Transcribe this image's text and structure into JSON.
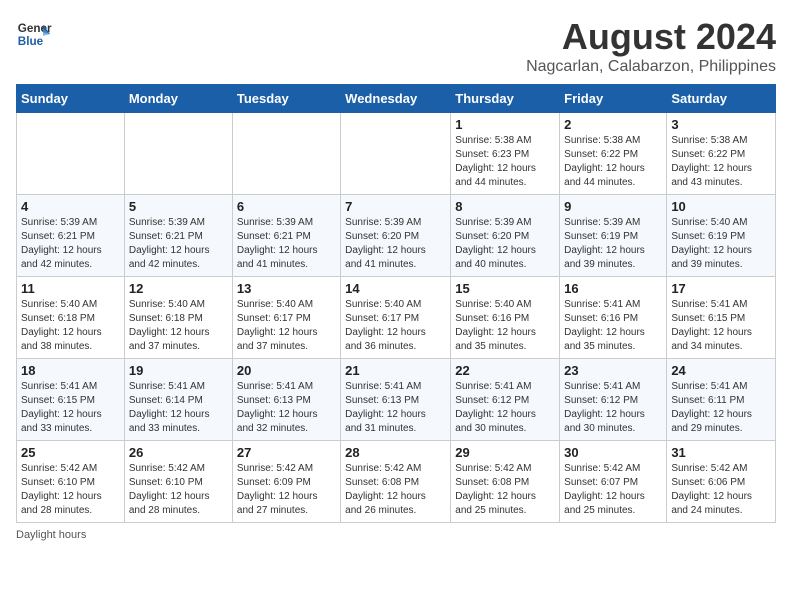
{
  "header": {
    "logo_line1": "General",
    "logo_line2": "Blue",
    "title": "August 2024",
    "subtitle": "Nagcarlan, Calabarzon, Philippines"
  },
  "days_of_week": [
    "Sunday",
    "Monday",
    "Tuesday",
    "Wednesday",
    "Thursday",
    "Friday",
    "Saturday"
  ],
  "weeks": [
    [
      {
        "day": "",
        "info": ""
      },
      {
        "day": "",
        "info": ""
      },
      {
        "day": "",
        "info": ""
      },
      {
        "day": "",
        "info": ""
      },
      {
        "day": "1",
        "info": "Sunrise: 5:38 AM\nSunset: 6:23 PM\nDaylight: 12 hours\nand 44 minutes."
      },
      {
        "day": "2",
        "info": "Sunrise: 5:38 AM\nSunset: 6:22 PM\nDaylight: 12 hours\nand 44 minutes."
      },
      {
        "day": "3",
        "info": "Sunrise: 5:38 AM\nSunset: 6:22 PM\nDaylight: 12 hours\nand 43 minutes."
      }
    ],
    [
      {
        "day": "4",
        "info": "Sunrise: 5:39 AM\nSunset: 6:21 PM\nDaylight: 12 hours\nand 42 minutes."
      },
      {
        "day": "5",
        "info": "Sunrise: 5:39 AM\nSunset: 6:21 PM\nDaylight: 12 hours\nand 42 minutes."
      },
      {
        "day": "6",
        "info": "Sunrise: 5:39 AM\nSunset: 6:21 PM\nDaylight: 12 hours\nand 41 minutes."
      },
      {
        "day": "7",
        "info": "Sunrise: 5:39 AM\nSunset: 6:20 PM\nDaylight: 12 hours\nand 41 minutes."
      },
      {
        "day": "8",
        "info": "Sunrise: 5:39 AM\nSunset: 6:20 PM\nDaylight: 12 hours\nand 40 minutes."
      },
      {
        "day": "9",
        "info": "Sunrise: 5:39 AM\nSunset: 6:19 PM\nDaylight: 12 hours\nand 39 minutes."
      },
      {
        "day": "10",
        "info": "Sunrise: 5:40 AM\nSunset: 6:19 PM\nDaylight: 12 hours\nand 39 minutes."
      }
    ],
    [
      {
        "day": "11",
        "info": "Sunrise: 5:40 AM\nSunset: 6:18 PM\nDaylight: 12 hours\nand 38 minutes."
      },
      {
        "day": "12",
        "info": "Sunrise: 5:40 AM\nSunset: 6:18 PM\nDaylight: 12 hours\nand 37 minutes."
      },
      {
        "day": "13",
        "info": "Sunrise: 5:40 AM\nSunset: 6:17 PM\nDaylight: 12 hours\nand 37 minutes."
      },
      {
        "day": "14",
        "info": "Sunrise: 5:40 AM\nSunset: 6:17 PM\nDaylight: 12 hours\nand 36 minutes."
      },
      {
        "day": "15",
        "info": "Sunrise: 5:40 AM\nSunset: 6:16 PM\nDaylight: 12 hours\nand 35 minutes."
      },
      {
        "day": "16",
        "info": "Sunrise: 5:41 AM\nSunset: 6:16 PM\nDaylight: 12 hours\nand 35 minutes."
      },
      {
        "day": "17",
        "info": "Sunrise: 5:41 AM\nSunset: 6:15 PM\nDaylight: 12 hours\nand 34 minutes."
      }
    ],
    [
      {
        "day": "18",
        "info": "Sunrise: 5:41 AM\nSunset: 6:15 PM\nDaylight: 12 hours\nand 33 minutes."
      },
      {
        "day": "19",
        "info": "Sunrise: 5:41 AM\nSunset: 6:14 PM\nDaylight: 12 hours\nand 33 minutes."
      },
      {
        "day": "20",
        "info": "Sunrise: 5:41 AM\nSunset: 6:13 PM\nDaylight: 12 hours\nand 32 minutes."
      },
      {
        "day": "21",
        "info": "Sunrise: 5:41 AM\nSunset: 6:13 PM\nDaylight: 12 hours\nand 31 minutes."
      },
      {
        "day": "22",
        "info": "Sunrise: 5:41 AM\nSunset: 6:12 PM\nDaylight: 12 hours\nand 30 minutes."
      },
      {
        "day": "23",
        "info": "Sunrise: 5:41 AM\nSunset: 6:12 PM\nDaylight: 12 hours\nand 30 minutes."
      },
      {
        "day": "24",
        "info": "Sunrise: 5:41 AM\nSunset: 6:11 PM\nDaylight: 12 hours\nand 29 minutes."
      }
    ],
    [
      {
        "day": "25",
        "info": "Sunrise: 5:42 AM\nSunset: 6:10 PM\nDaylight: 12 hours\nand 28 minutes."
      },
      {
        "day": "26",
        "info": "Sunrise: 5:42 AM\nSunset: 6:10 PM\nDaylight: 12 hours\nand 28 minutes."
      },
      {
        "day": "27",
        "info": "Sunrise: 5:42 AM\nSunset: 6:09 PM\nDaylight: 12 hours\nand 27 minutes."
      },
      {
        "day": "28",
        "info": "Sunrise: 5:42 AM\nSunset: 6:08 PM\nDaylight: 12 hours\nand 26 minutes."
      },
      {
        "day": "29",
        "info": "Sunrise: 5:42 AM\nSunset: 6:08 PM\nDaylight: 12 hours\nand 25 minutes."
      },
      {
        "day": "30",
        "info": "Sunrise: 5:42 AM\nSunset: 6:07 PM\nDaylight: 12 hours\nand 25 minutes."
      },
      {
        "day": "31",
        "info": "Sunrise: 5:42 AM\nSunset: 6:06 PM\nDaylight: 12 hours\nand 24 minutes."
      }
    ]
  ],
  "footer": {
    "note": "Daylight hours"
  }
}
